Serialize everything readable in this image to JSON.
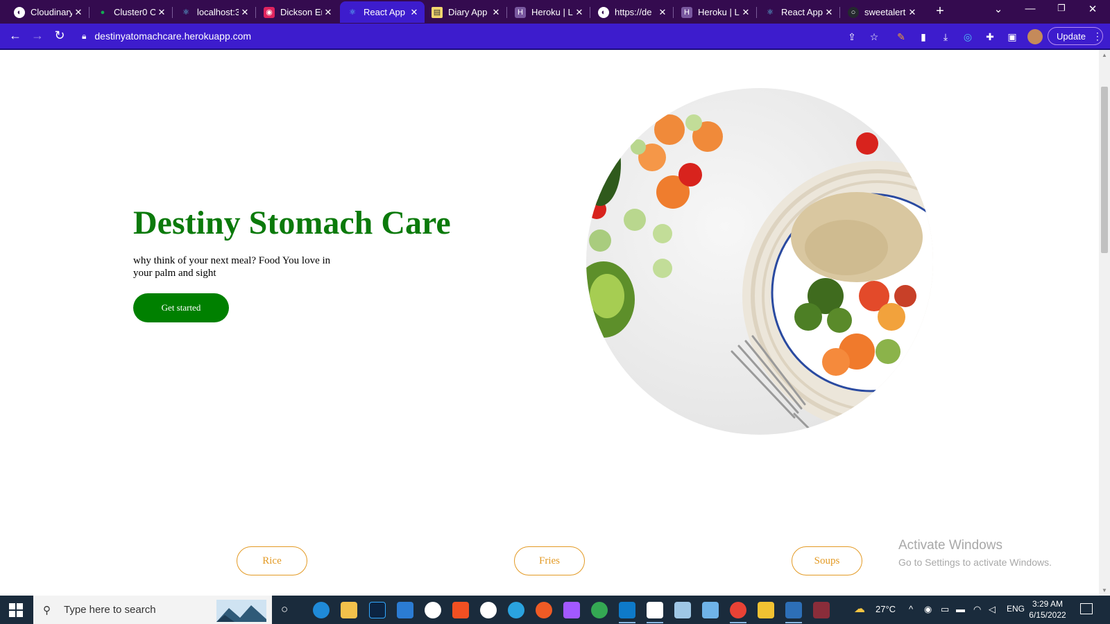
{
  "browser": {
    "tabs": [
      {
        "title": "Cloudinary",
        "favicon": "globe-icon",
        "fav_color": "#ffffff",
        "active": false
      },
      {
        "title": "Cluster0 O",
        "favicon": "mongodb-leaf-icon",
        "fav_color": "#13aa52",
        "active": false
      },
      {
        "title": "localhost:3",
        "favicon": "react-icon",
        "fav_color": "#61dafb",
        "active": false
      },
      {
        "title": "Dickson Er",
        "favicon": "app-icon",
        "fav_color": "#e0245e",
        "active": false
      },
      {
        "title": "React App",
        "favicon": "react-icon",
        "fav_color": "#61dafb",
        "active": true
      },
      {
        "title": "Diary App",
        "favicon": "note-icon",
        "fav_color": "#f5d76e",
        "active": false
      },
      {
        "title": "Heroku | L",
        "favicon": "heroku-icon",
        "fav_color": "#79589f",
        "active": false
      },
      {
        "title": "https://de",
        "favicon": "globe-icon",
        "fav_color": "#ffffff",
        "active": false
      },
      {
        "title": "Heroku | L",
        "favicon": "heroku-icon",
        "fav_color": "#79589f",
        "active": false
      },
      {
        "title": "React App",
        "favicon": "react-icon",
        "fav_color": "#61dafb",
        "active": false
      },
      {
        "title": "sweetalert",
        "favicon": "github-icon",
        "fav_color": "#24292e",
        "active": false
      }
    ],
    "close_glyph": "✕",
    "new_tab_glyph": "+",
    "url": "destinyatomachcare.herokuapp.com",
    "update_label": "Update"
  },
  "hero": {
    "title": "Destiny Stomach Care",
    "subtitle": "why think of your next meal? Food You love in your palm and sight",
    "cta": "Get started"
  },
  "categories": [
    {
      "label": "Rice"
    },
    {
      "label": "Fries"
    },
    {
      "label": "Soups"
    }
  ],
  "watermark": {
    "title": "Activate Windows",
    "subtitle": "Go to Settings to activate Windows."
  },
  "taskbar": {
    "search_placeholder": "Type here to search",
    "weather": "27°C",
    "language": "ENG",
    "time": "3:29 AM",
    "date": "6/15/2022"
  },
  "colors": {
    "tabstrip": "#340b4f",
    "toolbar": "#3d1ccd",
    "brand_green": "#0b7a0b",
    "accent_orange": "#e39a24"
  }
}
